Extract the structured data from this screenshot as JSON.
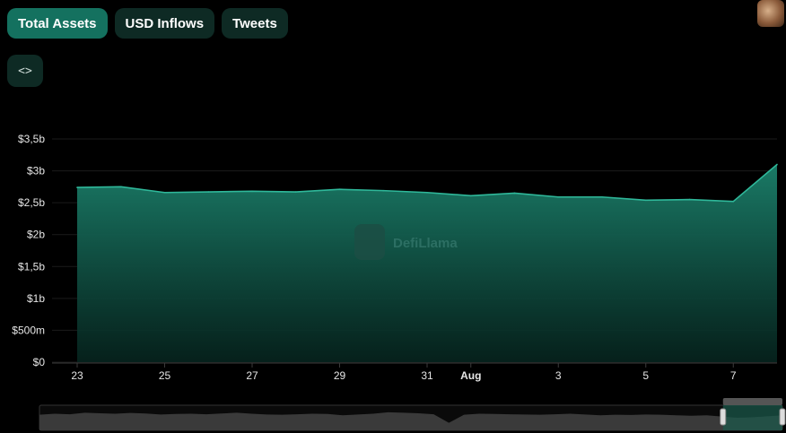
{
  "tabs": [
    {
      "label": "Total Assets",
      "active": true
    },
    {
      "label": "USD Inflows",
      "active": false
    },
    {
      "label": "Tweets",
      "active": false
    }
  ],
  "embed_icon": "code-brackets-icon",
  "embed_label": "<>",
  "watermark": "DefiLlama",
  "colors": {
    "accent": "#14715f",
    "line": "#2fb89a",
    "fill_top": "#1a7a66",
    "background": "#000000"
  },
  "chart_data": {
    "type": "area",
    "x": [
      "2023-07-23",
      "2023-07-24",
      "2023-07-25",
      "2023-07-26",
      "2023-07-27",
      "2023-07-28",
      "2023-07-29",
      "2023-07-30",
      "2023-07-31",
      "2023-08-01",
      "2023-08-02",
      "2023-08-03",
      "2023-08-04",
      "2023-08-05",
      "2023-08-06",
      "2023-08-07",
      "2023-08-08"
    ],
    "values": [
      2.74,
      2.75,
      2.66,
      2.67,
      2.68,
      2.67,
      2.71,
      2.69,
      2.66,
      2.61,
      2.65,
      2.59,
      2.59,
      2.54,
      2.55,
      2.52,
      3.1
    ],
    "unit": "b",
    "ylim": [
      0,
      3.5
    ],
    "yticks": [
      {
        "value": 0,
        "label": "$0"
      },
      {
        "value": 0.5,
        "label": "$500m"
      },
      {
        "value": 1,
        "label": "$1b"
      },
      {
        "value": 1.5,
        "label": "$1,5b"
      },
      {
        "value": 2,
        "label": "$2b"
      },
      {
        "value": 2.5,
        "label": "$2,5b"
      },
      {
        "value": 3,
        "label": "$3b"
      },
      {
        "value": 3.5,
        "label": "$3,5b"
      }
    ],
    "xticks": [
      {
        "index": 0,
        "label": "23",
        "bold": false
      },
      {
        "index": 2,
        "label": "25",
        "bold": false
      },
      {
        "index": 4,
        "label": "27",
        "bold": false
      },
      {
        "index": 6,
        "label": "29",
        "bold": false
      },
      {
        "index": 8,
        "label": "31",
        "bold": false
      },
      {
        "index": 9,
        "label": "Aug",
        "bold": true
      },
      {
        "index": 11,
        "label": "3",
        "bold": false
      },
      {
        "index": 13,
        "label": "5",
        "bold": false
      },
      {
        "index": 15,
        "label": "7",
        "bold": false
      }
    ],
    "grid": "horizontal",
    "xlabel": "",
    "ylabel": "",
    "title": ""
  },
  "brush": {
    "overview_values": [
      0.62,
      0.66,
      0.64,
      0.7,
      0.68,
      0.66,
      0.69,
      0.67,
      0.63,
      0.65,
      0.66,
      0.64,
      0.67,
      0.7,
      0.66,
      0.63,
      0.62,
      0.64,
      0.66,
      0.65,
      0.6,
      0.63,
      0.66,
      0.72,
      0.7,
      0.68,
      0.64,
      0.3,
      0.62,
      0.66,
      0.65,
      0.64,
      0.63,
      0.62,
      0.64,
      0.66,
      0.63,
      0.6,
      0.62,
      0.61,
      0.63,
      0.62,
      0.6,
      0.58,
      0.6,
      0.55,
      0.5,
      0.52,
      0.56,
      0.6
    ],
    "selection_start": 0.92,
    "selection_end": 1.0
  }
}
